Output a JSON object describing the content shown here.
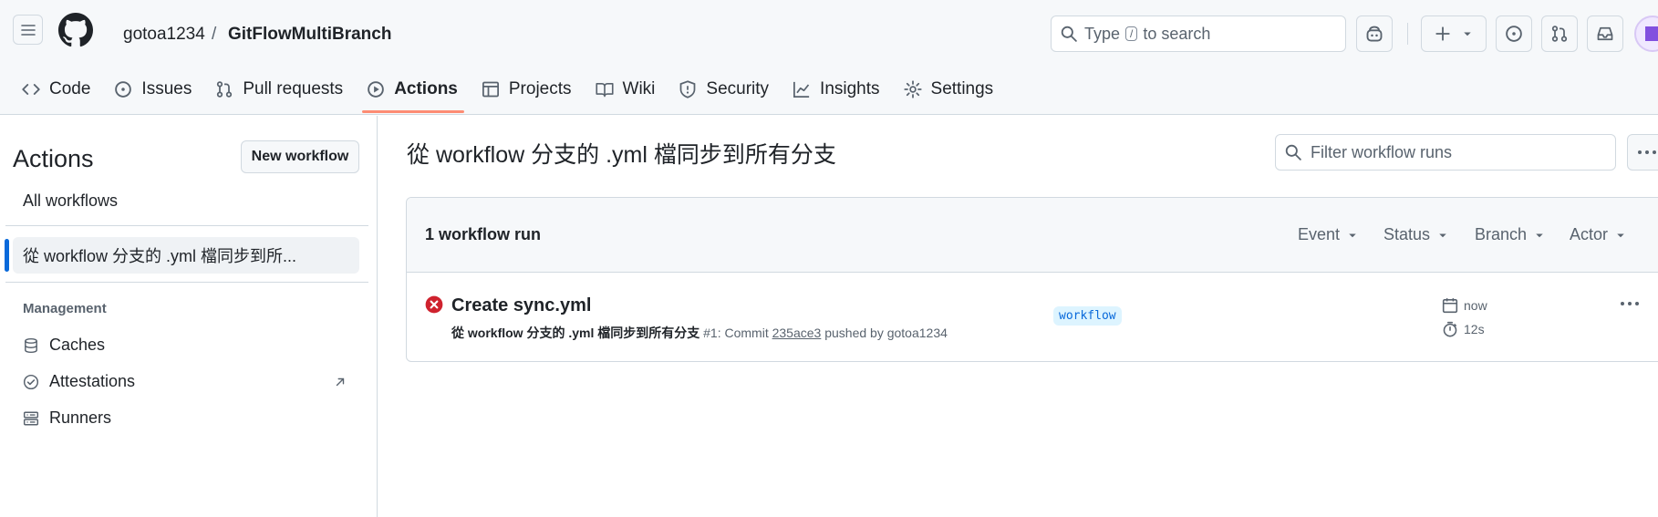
{
  "header": {
    "owner": "gotoa1234",
    "separator": "/",
    "repo": "GitFlowMultiBranch",
    "search": {
      "prefix": "Type",
      "key": "/",
      "suffix": "to search"
    }
  },
  "tabs": [
    {
      "label": "Code",
      "icon": "code-icon"
    },
    {
      "label": "Issues",
      "icon": "issue-icon"
    },
    {
      "label": "Pull requests",
      "icon": "pull-request-icon"
    },
    {
      "label": "Actions",
      "icon": "play-icon",
      "active": true
    },
    {
      "label": "Projects",
      "icon": "table-icon"
    },
    {
      "label": "Wiki",
      "icon": "book-icon"
    },
    {
      "label": "Security",
      "icon": "shield-icon"
    },
    {
      "label": "Insights",
      "icon": "graph-icon"
    },
    {
      "label": "Settings",
      "icon": "gear-icon"
    }
  ],
  "sidebar": {
    "title": "Actions",
    "new_workflow": "New workflow",
    "all_workflows": "All workflows",
    "selected_workflow": "從 workflow 分支的 .yml 檔同步到所...",
    "management_heading": "Management",
    "items": [
      {
        "label": "Caches",
        "icon": "database-icon"
      },
      {
        "label": "Attestations",
        "icon": "verified-icon"
      },
      {
        "label": "Runners",
        "icon": "server-icon"
      }
    ]
  },
  "main": {
    "title": "從 workflow 分支的 .yml 檔同步到所有分支",
    "filter_placeholder": "Filter workflow runs",
    "run_count": "1 workflow run",
    "filters": [
      "Event",
      "Status",
      "Branch",
      "Actor"
    ],
    "run": {
      "title": "Create sync.yml",
      "workflow_name": "從 workflow 分支的 .yml 檔同步到所有分支",
      "run_number": "#1: Commit",
      "commit": "235ace3",
      "pushed_by": "pushed by gotoa1234",
      "branch": "workflow",
      "time": "now",
      "duration": "12s",
      "status": "failure"
    }
  },
  "colors": {
    "accent": "#0969da",
    "tab_underline": "#fd8c73",
    "failure": "#cf222e",
    "avatar": "#8250df"
  }
}
